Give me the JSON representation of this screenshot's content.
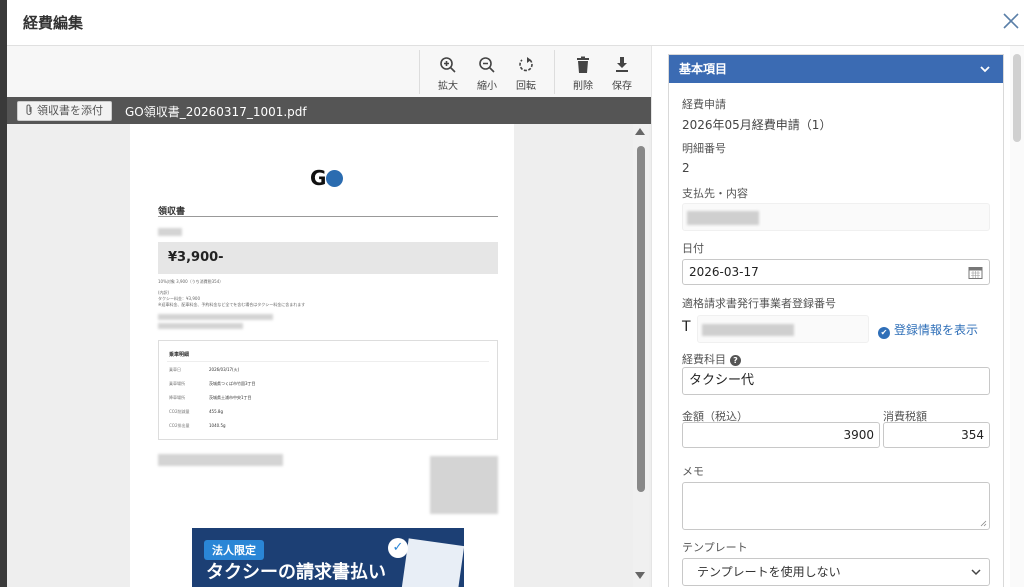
{
  "modal": {
    "title": "経費編集"
  },
  "toolbar": {
    "zoom_in": "拡大",
    "zoom_out": "縮小",
    "rotate": "回転",
    "delete": "削除",
    "save": "保存"
  },
  "filebar": {
    "attach_label": "領収書を添付",
    "filename": "GO領収書_20260317_1001.pdf"
  },
  "receipt": {
    "logo": "GO",
    "title": "領収書",
    "amount": "¥3,900-",
    "tax_line": "10%対象 3,900（うち消費税354）",
    "breakdown_label": "(内訳)",
    "fare_line": "タクシー料金：¥3,900",
    "note_line": "※迎車料金、配車料金、予約料金など全てを含む場合はタクシー料金に含まれます",
    "detail_title": "乗車明細",
    "detail_rows": [
      {
        "label": "乗車日",
        "value": "2026/03/17(火)"
      },
      {
        "label": "乗車場所",
        "value": "茨城県つくば市竹園3丁目"
      },
      {
        "label": "降車場所",
        "value": "茨城県土浦市中央1丁目"
      },
      {
        "label": "CO2削減量",
        "value": "455.8g"
      },
      {
        "label": "CO2排出量",
        "value": "1040.5g"
      }
    ],
    "banner_tag": "法人限定",
    "banner_text": "タクシーの請求書払い"
  },
  "panel": {
    "section_title": "基本項目",
    "fields": {
      "expense_request_label": "経費申請",
      "expense_request_value": "2026年05月経費申請（1）",
      "detail_no_label": "明細番号",
      "detail_no_value": "2",
      "payee_label": "支払先・内容",
      "date_label": "日付",
      "date_value": "2026-03-17",
      "invoice_reg_label": "適格請求書発行事業者登録番号",
      "invoice_reg_prefix": "T",
      "invoice_link": "登録情報を表示",
      "account_label": "経費科目",
      "account_value": "タクシー代",
      "amount_label": "金額（税込）",
      "amount_value": "3900",
      "tax_label": "消費税額",
      "tax_value": "354",
      "memo_label": "メモ",
      "memo_value": "",
      "template_label": "テンプレート",
      "template_value": "テンプレートを使用しない"
    }
  },
  "colors": {
    "accent": "#3b6bb3",
    "link": "#2f6fb8"
  }
}
